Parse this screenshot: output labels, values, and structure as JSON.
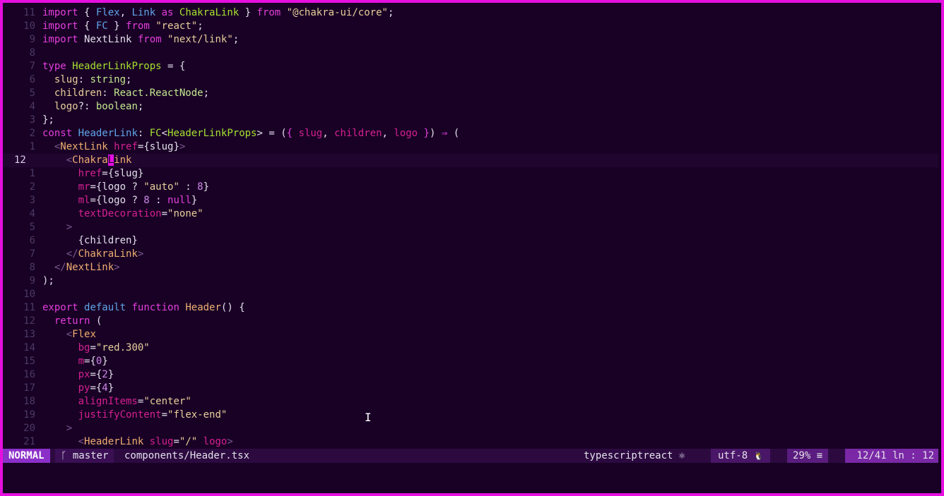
{
  "editor": {
    "lines": [
      {
        "num": "11",
        "tokens": [
          [
            "k",
            "import"
          ],
          [
            "w",
            " { "
          ],
          [
            "b",
            "Flex"
          ],
          [
            "w",
            ", "
          ],
          [
            "b",
            "Link"
          ],
          [
            "k",
            " as "
          ],
          [
            "t",
            "ChakraLink"
          ],
          [
            "w",
            " } "
          ],
          [
            "k",
            "from"
          ],
          [
            "w",
            " "
          ],
          [
            "y",
            "\"@chakra-ui/core\""
          ],
          [
            "w",
            ";"
          ]
        ]
      },
      {
        "num": "10",
        "tokens": [
          [
            "k",
            "import"
          ],
          [
            "w",
            " { "
          ],
          [
            "b",
            "FC"
          ],
          [
            "w",
            " } "
          ],
          [
            "k",
            "from"
          ],
          [
            "w",
            " "
          ],
          [
            "y",
            "\"react\""
          ],
          [
            "w",
            ";"
          ]
        ]
      },
      {
        "num": "9",
        "tokens": [
          [
            "k",
            "import"
          ],
          [
            "w",
            " NextLink "
          ],
          [
            "k",
            "from"
          ],
          [
            "w",
            " "
          ],
          [
            "y",
            "\"next/link\""
          ],
          [
            "w",
            ";"
          ]
        ]
      },
      {
        "num": "8",
        "tokens": []
      },
      {
        "num": "7",
        "tokens": [
          [
            "k",
            "type"
          ],
          [
            "w",
            " "
          ],
          [
            "t",
            "HeaderLinkProps"
          ],
          [
            "w",
            " = {"
          ]
        ]
      },
      {
        "num": "6",
        "tokens": [
          [
            "w",
            "  "
          ],
          [
            "y",
            "slug"
          ],
          [
            "w",
            ": "
          ],
          [
            "g",
            "string"
          ],
          [
            "w",
            ";"
          ]
        ]
      },
      {
        "num": "5",
        "tokens": [
          [
            "w",
            "  "
          ],
          [
            "y",
            "children"
          ],
          [
            "w",
            ": "
          ],
          [
            "g",
            "React.ReactNode"
          ],
          [
            "w",
            ";"
          ]
        ]
      },
      {
        "num": "4",
        "tokens": [
          [
            "w",
            "  "
          ],
          [
            "y",
            "logo"
          ],
          [
            "w",
            "?: "
          ],
          [
            "g",
            "boolean"
          ],
          [
            "w",
            ";"
          ]
        ]
      },
      {
        "num": "3",
        "tokens": [
          [
            "w",
            "};"
          ]
        ]
      },
      {
        "num": "2",
        "tokens": [
          [
            "k",
            "const"
          ],
          [
            "w",
            " "
          ],
          [
            "b",
            "HeaderLink"
          ],
          [
            "w",
            ": "
          ],
          [
            "t",
            "FC"
          ],
          [
            "w",
            "<"
          ],
          [
            "t",
            "HeaderLinkProps"
          ],
          [
            "w",
            "> = ("
          ],
          [
            "k",
            "{"
          ],
          [
            "w",
            " "
          ],
          [
            "p",
            "slug"
          ],
          [
            "w",
            ", "
          ],
          [
            "p",
            "children"
          ],
          [
            "w",
            ", "
          ],
          [
            "p",
            "logo"
          ],
          [
            "w",
            " "
          ],
          [
            "k",
            "}"
          ],
          [
            "w",
            ") "
          ],
          [
            "k",
            "⇒"
          ],
          [
            "w",
            " ("
          ]
        ]
      },
      {
        "num": "1",
        "tokens": [
          [
            "w",
            "  "
          ],
          [
            "d",
            "<"
          ],
          [
            "o",
            "NextLink"
          ],
          [
            "w",
            " "
          ],
          [
            "p",
            "href"
          ],
          [
            "w",
            "={slug}"
          ],
          [
            "d",
            ">"
          ]
        ]
      },
      {
        "num": "12",
        "current": true,
        "tokens": [
          [
            "w",
            "    "
          ],
          [
            "d",
            "<"
          ],
          [
            "o",
            "Chakra"
          ],
          [
            "cursor",
            "L"
          ],
          [
            "o",
            "ink"
          ]
        ]
      },
      {
        "num": "1",
        "tokens": [
          [
            "w",
            "      "
          ],
          [
            "p",
            "href"
          ],
          [
            "w",
            "={slug}"
          ]
        ]
      },
      {
        "num": "2",
        "tokens": [
          [
            "w",
            "      "
          ],
          [
            "p",
            "mr"
          ],
          [
            "w",
            "={logo ? "
          ],
          [
            "y",
            "\"auto\""
          ],
          [
            "w",
            " : "
          ],
          [
            "n",
            "8"
          ],
          [
            "w",
            "}"
          ]
        ]
      },
      {
        "num": "3",
        "tokens": [
          [
            "w",
            "      "
          ],
          [
            "p",
            "ml"
          ],
          [
            "w",
            "={logo ? "
          ],
          [
            "n",
            "8"
          ],
          [
            "w",
            " : "
          ],
          [
            "k",
            "null"
          ],
          [
            "w",
            "}"
          ]
        ]
      },
      {
        "num": "4",
        "tokens": [
          [
            "w",
            "      "
          ],
          [
            "p",
            "textDecoration"
          ],
          [
            "w",
            "="
          ],
          [
            "y",
            "\"none\""
          ]
        ]
      },
      {
        "num": "5",
        "tokens": [
          [
            "w",
            "    "
          ],
          [
            "d",
            ">"
          ]
        ]
      },
      {
        "num": "6",
        "tokens": [
          [
            "w",
            "      {children}"
          ]
        ]
      },
      {
        "num": "7",
        "tokens": [
          [
            "w",
            "    "
          ],
          [
            "d",
            "</"
          ],
          [
            "o",
            "ChakraLink"
          ],
          [
            "d",
            ">"
          ]
        ]
      },
      {
        "num": "8",
        "tokens": [
          [
            "w",
            "  "
          ],
          [
            "d",
            "</"
          ],
          [
            "o",
            "NextLink"
          ],
          [
            "d",
            ">"
          ]
        ]
      },
      {
        "num": "9",
        "tokens": [
          [
            "w",
            ");"
          ]
        ]
      },
      {
        "num": "10",
        "tokens": []
      },
      {
        "num": "11",
        "tokens": [
          [
            "k",
            "export"
          ],
          [
            "w",
            " "
          ],
          [
            "b",
            "default"
          ],
          [
            "w",
            " "
          ],
          [
            "k",
            "function"
          ],
          [
            "w",
            " "
          ],
          [
            "o",
            "Header"
          ],
          [
            "w",
            "() {"
          ]
        ]
      },
      {
        "num": "12",
        "tokens": [
          [
            "w",
            "  "
          ],
          [
            "k",
            "return"
          ],
          [
            "w",
            " ("
          ]
        ]
      },
      {
        "num": "13",
        "tokens": [
          [
            "w",
            "    "
          ],
          [
            "d",
            "<"
          ],
          [
            "o",
            "Flex"
          ]
        ]
      },
      {
        "num": "14",
        "tokens": [
          [
            "w",
            "      "
          ],
          [
            "p",
            "bg"
          ],
          [
            "w",
            "="
          ],
          [
            "y",
            "\"red.300\""
          ]
        ]
      },
      {
        "num": "15",
        "tokens": [
          [
            "w",
            "      "
          ],
          [
            "p",
            "m"
          ],
          [
            "w",
            "={"
          ],
          [
            "n",
            "0"
          ],
          [
            "w",
            "}"
          ]
        ]
      },
      {
        "num": "16",
        "tokens": [
          [
            "w",
            "      "
          ],
          [
            "p",
            "px"
          ],
          [
            "w",
            "={"
          ],
          [
            "n",
            "2"
          ],
          [
            "w",
            "}"
          ]
        ]
      },
      {
        "num": "17",
        "tokens": [
          [
            "w",
            "      "
          ],
          [
            "p",
            "py"
          ],
          [
            "w",
            "={"
          ],
          [
            "n",
            "4"
          ],
          [
            "w",
            "}"
          ]
        ]
      },
      {
        "num": "18",
        "tokens": [
          [
            "w",
            "      "
          ],
          [
            "p",
            "alignItems"
          ],
          [
            "w",
            "="
          ],
          [
            "y",
            "\"center\""
          ]
        ]
      },
      {
        "num": "19",
        "tokens": [
          [
            "w",
            "      "
          ],
          [
            "p",
            "justifyContent"
          ],
          [
            "w",
            "="
          ],
          [
            "y",
            "\"flex-end\""
          ]
        ]
      },
      {
        "num": "20",
        "tokens": [
          [
            "w",
            "    "
          ],
          [
            "d",
            ">"
          ]
        ]
      },
      {
        "num": "21",
        "tokens": [
          [
            "w",
            "      "
          ],
          [
            "d",
            "<"
          ],
          [
            "o",
            "HeaderLink"
          ],
          [
            "w",
            " "
          ],
          [
            "p",
            "slug"
          ],
          [
            "w",
            "="
          ],
          [
            "y",
            "\"/\""
          ],
          [
            "w",
            " "
          ],
          [
            "p",
            "logo"
          ],
          [
            "d",
            ">"
          ]
        ]
      }
    ]
  },
  "statusline": {
    "mode": "NORMAL",
    "branch_icon": "ᚴ",
    "branch": "master",
    "file": "components/Header.tsx",
    "filetype": "typescriptreact",
    "filetype_icon": "⚛",
    "encoding": "utf-8",
    "os_icon": "🐧",
    "percent": "29%",
    "percent_icon": "≡",
    "position": "12/41 ln : 12"
  },
  "mouse_cursor_icon": "I"
}
